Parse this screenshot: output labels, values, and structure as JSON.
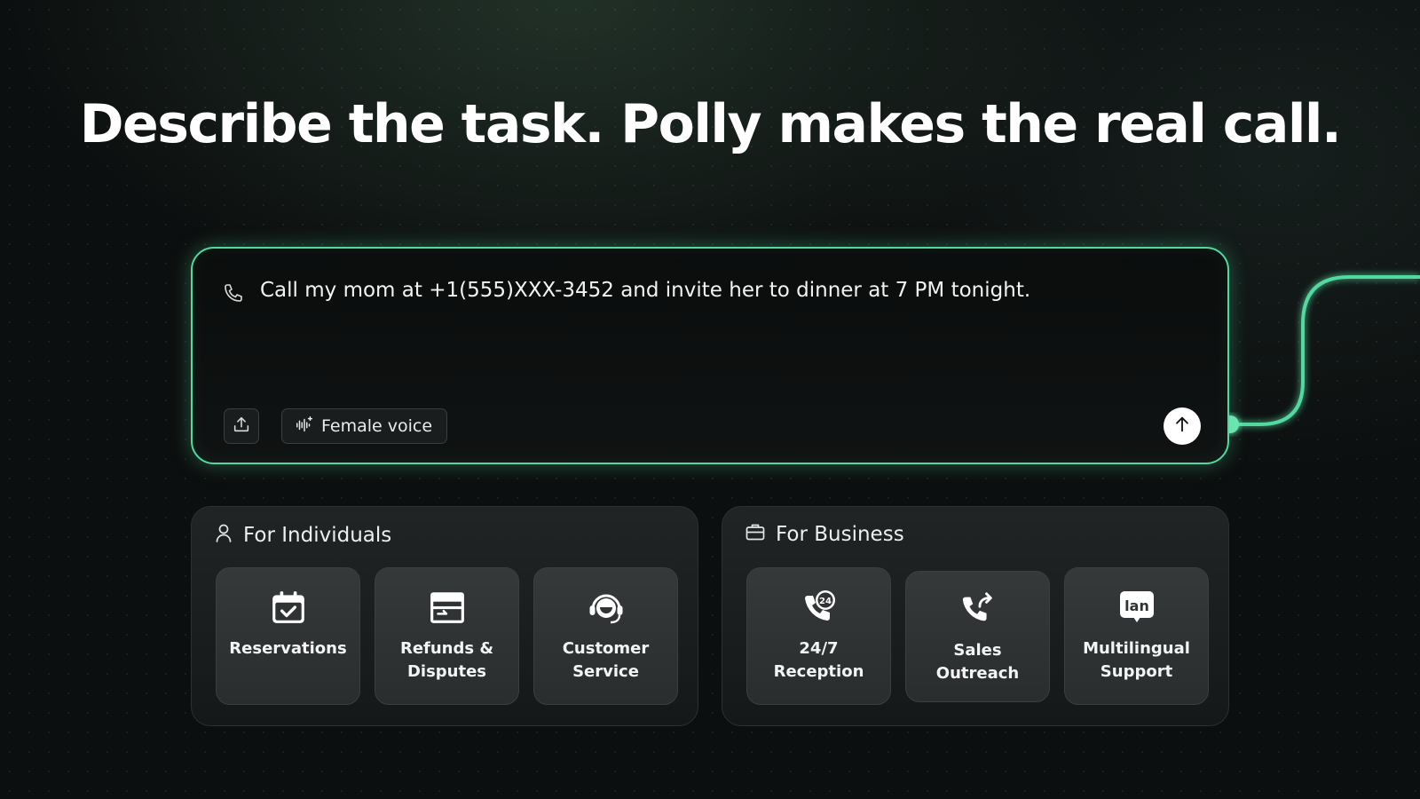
{
  "headline": "Describe the task. Polly makes the real call.",
  "composer": {
    "prompt_text": "Call my mom at +1(555)XXX-3452 and invite her to dinner at 7 PM tonight.",
    "voice_label": "Female voice",
    "icons": {
      "phone": "phone-icon",
      "upload": "upload-icon",
      "voice": "waveform-icon",
      "send": "arrow-up-icon"
    }
  },
  "colors": {
    "accent": "#52d9a0",
    "background": "#0c0f0f",
    "card": "#2f3334"
  },
  "individuals": {
    "title": "For Individuals",
    "icon": "person-icon",
    "cards": [
      {
        "label": "Reservations",
        "icon": "calendar-check-icon"
      },
      {
        "label": "Refunds &\nDisputes",
        "icon": "wallet-icon"
      },
      {
        "label": "Customer\nService",
        "icon": "headset-icon"
      }
    ]
  },
  "business": {
    "title": "For Business",
    "icon": "briefcase-icon",
    "cards": [
      {
        "label": "24/7\nReception",
        "icon": "phone-24-icon",
        "badge": "24"
      },
      {
        "label": "Sales\nOutreach",
        "icon": "phone-outgoing-icon"
      },
      {
        "label": "Multilingual\nSupport",
        "icon": "language-bubble-icon",
        "badge": "lan"
      }
    ]
  }
}
